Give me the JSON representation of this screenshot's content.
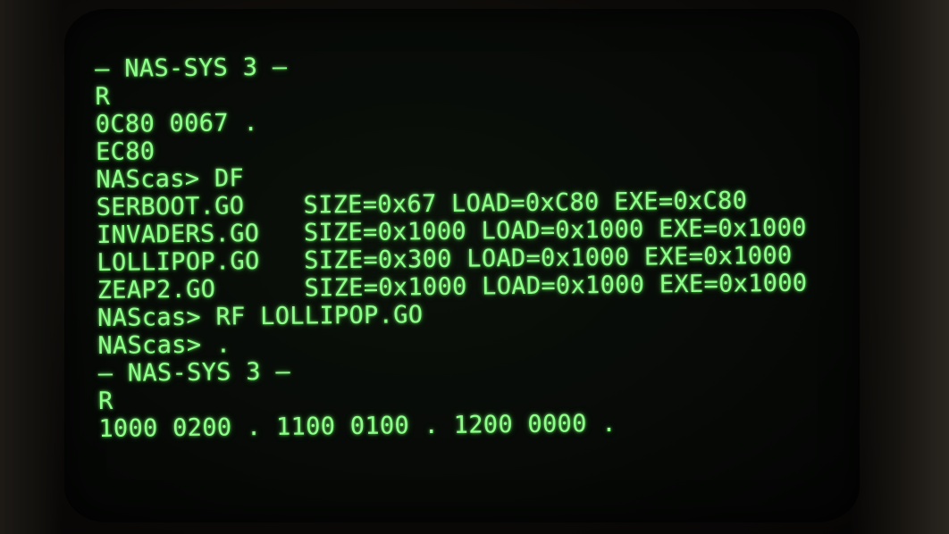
{
  "terminal": {
    "lines": [
      "— NAS-SYS 3 —",
      "R",
      "0C80 0067 .",
      "EC80",
      "NAScas> DF",
      "SERBOOT.GO    SIZE=0x67 LOAD=0xC80 EXE=0xC80",
      "INVADERS.GO   SIZE=0x1000 LOAD=0x1000 EXE=0x1000",
      "LOLLIPOP.GO   SIZE=0x300 LOAD=0x1000 EXE=0x1000",
      "ZEAP2.GO      SIZE=0x1000 LOAD=0x1000 EXE=0x1000",
      "NAScas> RF LOLLIPOP.GO",
      "NAScas> .",
      "— NAS-SYS 3 —",
      "R",
      "1000 0200 . 1100 0100 . 1200 0000 ."
    ]
  },
  "colors": {
    "phosphor": "#8dff8a",
    "screen_background": "#060806",
    "bezel": "#0c0a08"
  }
}
